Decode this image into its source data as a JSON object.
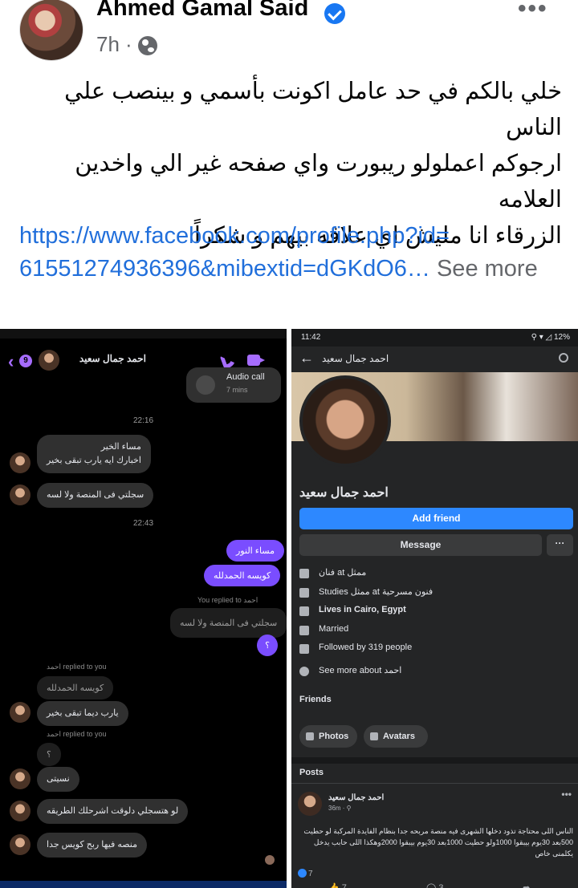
{
  "post": {
    "author": "Ahmed Gamal Said",
    "time": "7h",
    "separator": "·",
    "more_icon": "•••",
    "text_lines": [
      "خلي بالكم في حد عامل اكونت بأسمي و بينصب علي الناس",
      "ارجوكم اعملولو ريبورت واي صفحه غير الي واخدين العلامه",
      "الزرقاء انا مليش اي علاقه بيهم و شكراً"
    ],
    "link_line1": "https://www.facebook.com/profile.php?id=",
    "link_line2": "61551274936396&mibextid=dGKdO6…",
    "see_more": "See more"
  },
  "messenger": {
    "badge": "9",
    "contact_name": "احمد جمال سعيد",
    "call_title": "Audio call",
    "call_sub": "7 mins",
    "time1": "22:16",
    "time2": "22:43",
    "msg_in_1_line1": "مساء الخير",
    "msg_in_1_line2": "اخبارك ايه يارب تبقى بخير",
    "msg_in_2": "سجلتي فى المنصة ولا لسه",
    "msg_out_1": "مساء النور",
    "msg_out_2": "كويسه الحمدلله",
    "you_replied": "You replied to احمد",
    "quote_1": "سجلتي فى المنصة ولا لسه",
    "msg_out_3": "؟",
    "replied_to_you_1": "احمد replied to you",
    "quote_2": "كويسه الحمدلله",
    "msg_in_3": "يارب ديما تبقى بخير",
    "replied_to_you_2": "احمد replied to you",
    "quote_3": "؟",
    "msg_in_4": "نسيتى",
    "msg_in_5": "لو هتسجلي دلوقت اشرحلك الطريقه",
    "msg_in_6": "منصه فيها ربح كويس جدا"
  },
  "profile": {
    "clock": "11:42",
    "status_icons": "⚲ ▾ ◿ 12%",
    "nav_title": "احمد جمال سعيد",
    "name": "احمد جمال سعيد",
    "add_friend": "Add friend",
    "message": "Message",
    "more": "···",
    "info": [
      "فنان at ممثل",
      "Studies ممثل at فنون مسرحية",
      "Lives in Cairo, Egypt",
      "Married",
      "Followed by 319 people",
      "See more about احمد"
    ],
    "friends_label": "Friends",
    "photos_chip": "Photos",
    "avatars_chip": "Avatars",
    "posts_label": "Posts",
    "post_name": "احمد جمال سعيد",
    "post_time": "36m · ⚲",
    "post_more": "•••",
    "post_body": "الناس اللى محتاجة تذود دخلها الشهرى فيه منصة مربحه جدا بنظام الفايدة المركبة لو حطيت 500بعد 30يوم بيبقوا 1000ولو حطيت 1000بعد 30يوم بيبقوا 2000وهكذا اللى حابب يدخل يكلمنى خاص",
    "likes": "7",
    "like_count": "7",
    "comment_count": "3"
  }
}
